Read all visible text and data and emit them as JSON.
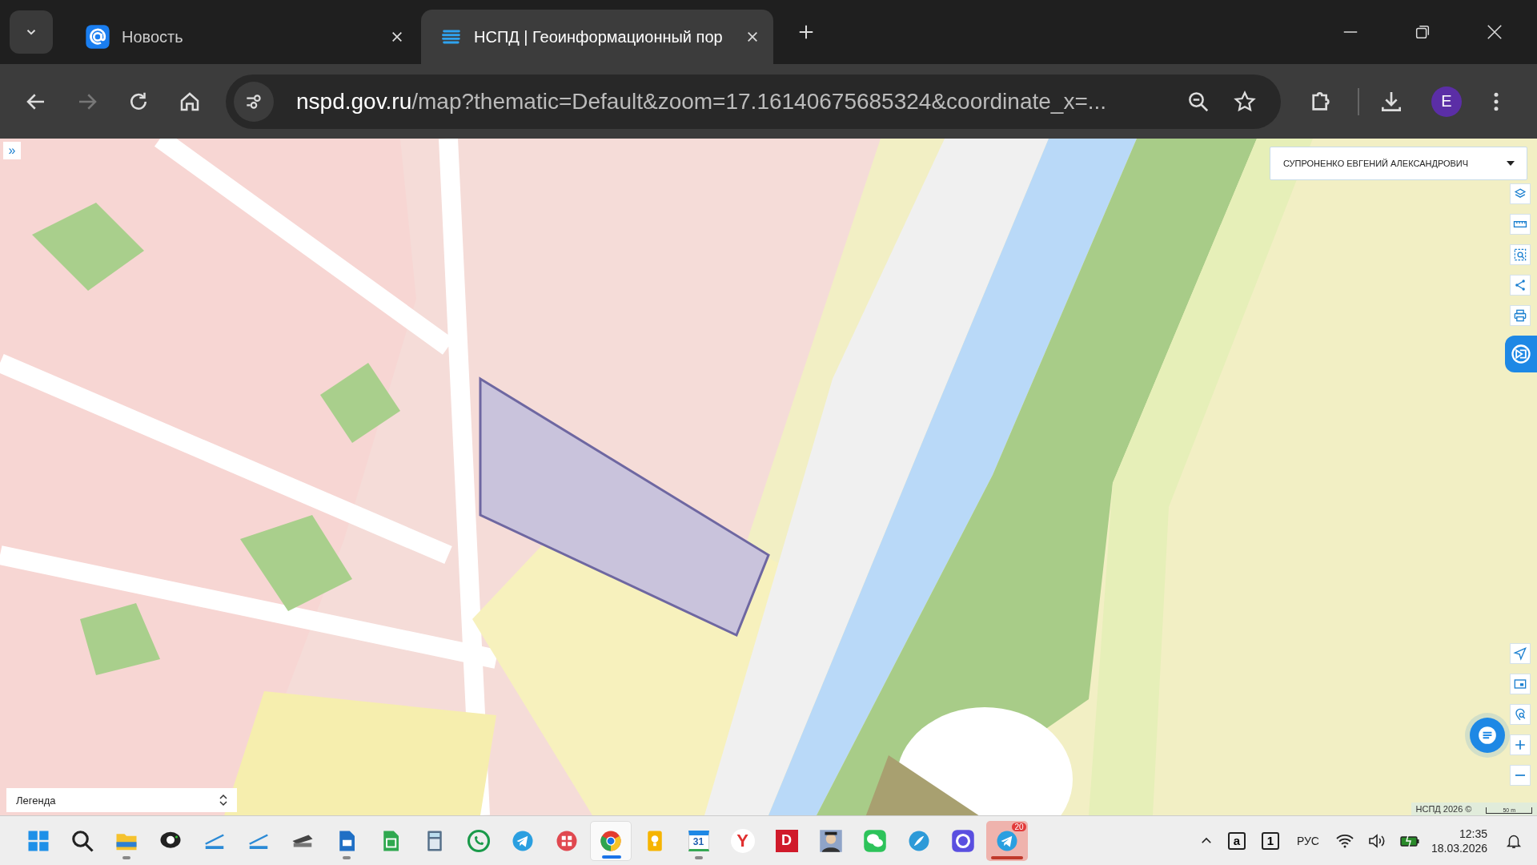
{
  "tabs": [
    {
      "title": "Новость",
      "kind": "mail",
      "selected": false
    },
    {
      "title": "НСПД | Геоинформационный пор",
      "kind": "nspd",
      "selected": true
    }
  ],
  "address_bar": {
    "host": "nspd.gov.ru",
    "path": "/map?thematic=Default&zoom=17.16140675685324&coordinate_x=..."
  },
  "profile": {
    "initial": "E"
  },
  "map": {
    "kind": "picture",
    "user_menu": "СУПРОНЕНКО ЕВГЕНИЙ АЛЕКСАНДРОВИЧ",
    "expand": "»",
    "legend": "Легенда",
    "copyright": "НСПД 2026 ©",
    "scale": "50 m",
    "top_tools": [
      {
        "kind": "layers"
      },
      {
        "kind": "ruler"
      },
      {
        "kind": "area"
      },
      {
        "kind": "share"
      },
      {
        "kind": "print"
      }
    ],
    "bottom_tools": [
      {
        "kind": "locate"
      },
      {
        "kind": "minimap"
      },
      {
        "kind": "geosearch"
      },
      {
        "kind": "plus"
      },
      {
        "kind": "minus"
      }
    ]
  },
  "taskbar": {
    "apps": [
      {
        "kind": "start",
        "running": false,
        "selected": false
      },
      {
        "kind": "search",
        "running": false,
        "selected": false
      },
      {
        "kind": "folder",
        "running": true,
        "selected": false
      },
      {
        "kind": "chat",
        "running": false,
        "selected": false
      },
      {
        "kind": "scanner",
        "running": false,
        "selected": false
      },
      {
        "kind": "scanner",
        "running": false,
        "selected": false
      },
      {
        "kind": "flatbed",
        "running": false,
        "selected": false
      },
      {
        "kind": "document",
        "running": true,
        "selected": false
      },
      {
        "kind": "sheet",
        "running": false,
        "selected": false
      },
      {
        "kind": "calculator",
        "running": false,
        "selected": false
      },
      {
        "kind": "whatsapp",
        "running": false,
        "selected": false
      },
      {
        "kind": "telegram",
        "running": false,
        "selected": false
      },
      {
        "kind": "grid",
        "running": false,
        "selected": false
      },
      {
        "kind": "chrome",
        "running": true,
        "selected": true
      },
      {
        "kind": "bulb",
        "running": false,
        "selected": false
      },
      {
        "kind": "calendar",
        "label": "31",
        "running": true,
        "selected": false
      },
      {
        "kind": "letter",
        "label": "Y",
        "running": false,
        "selected": false
      },
      {
        "kind": "redletter",
        "label": "D",
        "running": false,
        "selected": false
      },
      {
        "kind": "figure",
        "running": false,
        "selected": false
      },
      {
        "kind": "wechat",
        "running": false,
        "selected": false
      },
      {
        "kind": "bird",
        "running": false,
        "selected": false
      },
      {
        "kind": "messenger",
        "running": false,
        "selected": false
      },
      {
        "kind": "telegram",
        "badge": "20",
        "alert": true,
        "running": true,
        "selected": false
      }
    ],
    "keyboard_keys": [
      "a",
      "1"
    ],
    "language": "РУС",
    "time": "12:35",
    "date": "18.03.2026"
  }
}
